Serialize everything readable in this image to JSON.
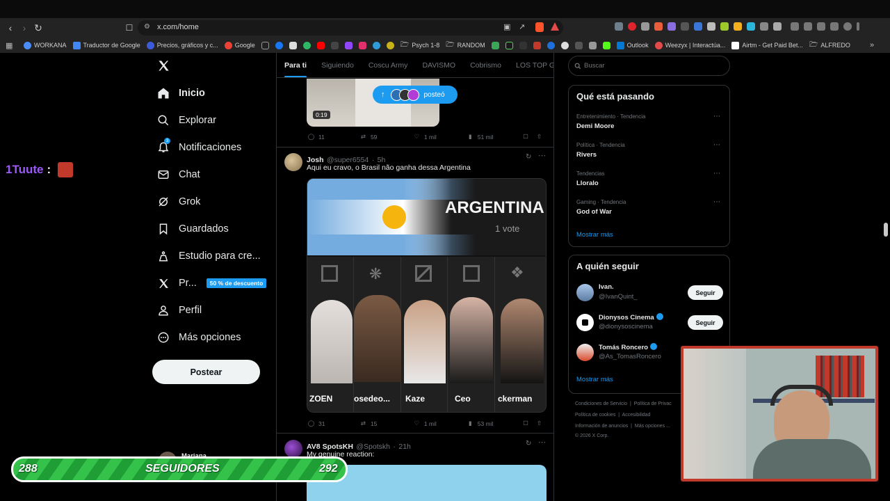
{
  "browser": {
    "url": "x.com/home",
    "bookmarks": [
      {
        "label": "WORKANA",
        "color": "#4b8bf5"
      },
      {
        "label": "Traductor de Google",
        "color": "#4285f4"
      },
      {
        "label": "Precios, gráficos y c...",
        "color": "#3b5bdb"
      },
      {
        "label": "Google",
        "color": "#ea4335"
      }
    ],
    "bookmarks_right": [
      {
        "label": "Psych 1-8"
      },
      {
        "label": "RANDOM"
      },
      {
        "label": "Outlook"
      },
      {
        "label": "Weezyx | Interactúa..."
      },
      {
        "label": "Airtm - Get Paid Bet..."
      },
      {
        "label": "ALFREDO"
      }
    ]
  },
  "nav": {
    "items": [
      {
        "label": "Inicio",
        "icon": "home-icon"
      },
      {
        "label": "Explorar",
        "icon": "search-icon"
      },
      {
        "label": "Notificaciones",
        "icon": "bell-icon",
        "badge": "3"
      },
      {
        "label": "Chat",
        "icon": "mail-icon"
      },
      {
        "label": "Grok",
        "icon": "grok-icon"
      },
      {
        "label": "Guardados",
        "icon": "bookmark-icon"
      },
      {
        "label": "Estudio para cre...",
        "icon": "studio-icon"
      },
      {
        "label": "Pr...",
        "icon": "x-logo-icon",
        "promo": "50 % de descuento"
      },
      {
        "label": "Perfil",
        "icon": "person-icon"
      },
      {
        "label": "Más opciones",
        "icon": "more-circle-icon"
      }
    ],
    "post_button": "Postear",
    "account_partial": "Mariana"
  },
  "timeline": {
    "tabs": [
      "Para ti",
      "Siguiendo",
      "Coscu Army",
      "DAVISMO",
      "Cobrismo",
      "LOS TOP GL"
    ],
    "new_posts_label": "posteó",
    "tweet1": {
      "video_duration": "0:19",
      "stats": {
        "replies": "11",
        "reposts": "59",
        "likes": "1 mil",
        "views": "51 mil"
      }
    },
    "tweet2": {
      "name": "Josh",
      "handle": "@super6554",
      "time": "5h",
      "text": "Aqui eu cravo, o Brasil não ganha dessa Argentina",
      "image": {
        "team": "ARGENTINA",
        "votes": "1 vote",
        "players": [
          "ZOEN",
          "osedeo...",
          "Kaze",
          "Ceo",
          "ckerman"
        ]
      },
      "stats": {
        "replies": "31",
        "reposts": "15",
        "likes": "1 mil",
        "views": "53 mil"
      }
    },
    "tweet3": {
      "name": "AV8 SpotsKH",
      "handle": "@Spotskh",
      "time": "21h",
      "text": "My genuine reaction:"
    }
  },
  "right": {
    "search_placeholder": "Buscar",
    "trends_title": "Qué está pasando",
    "trends": [
      {
        "meta": "Entretenimiento · Tendencia",
        "name": "Demi Moore"
      },
      {
        "meta": "Política · Tendencia",
        "name": "Rivers"
      },
      {
        "meta": "Tendencias",
        "name": "Lloralo"
      },
      {
        "meta": "Gaming · Tendencia",
        "name": "God of War"
      }
    ],
    "show_more": "Mostrar más",
    "follow_title": "A quién seguir",
    "follow": [
      {
        "name": "Ivan.",
        "handle": "@IvanQuint_",
        "button": "Seguir",
        "verified": false
      },
      {
        "name": "Dionysos Cinema",
        "handle": "@dionysoscinema",
        "button": "Seguir",
        "verified": true
      },
      {
        "name": "Tomás Roncero",
        "handle": "@As_TomasRoncero",
        "button": "Seguir",
        "verified": true
      }
    ],
    "follow_show_more": "Mostrar más",
    "footer": {
      "line1a": "Condiciones de Servicio",
      "line1b": "Política de Privac",
      "line2a": "Política de cookies",
      "line2b": "Accesibilidad",
      "line3a": "Información de anuncios",
      "line3b": "Más opciones ...",
      "copyright": "© 2026 X Corp."
    }
  },
  "overlays": {
    "username": "1Tuute",
    "counter_left": "288",
    "counter_label": "SEGUIDORES",
    "counter_right": "292"
  }
}
